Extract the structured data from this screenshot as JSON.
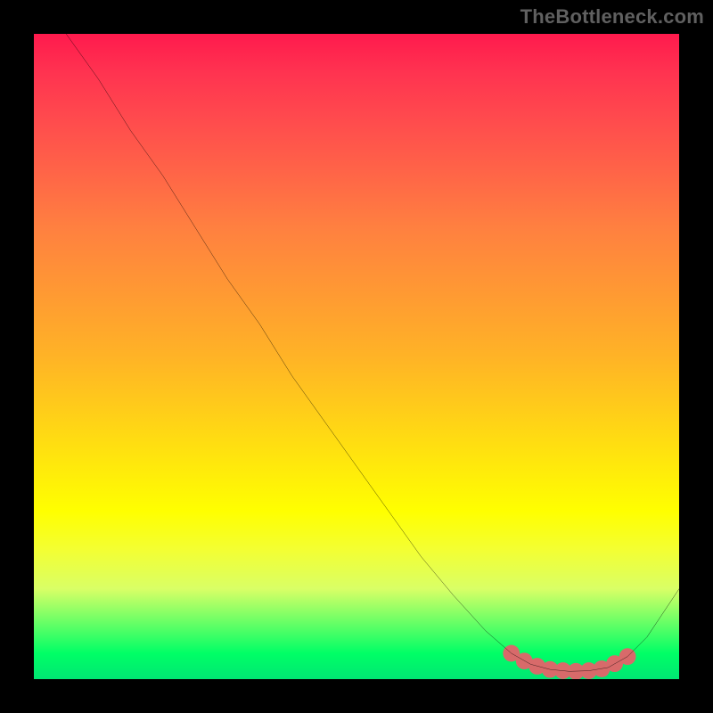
{
  "watermark": "TheBottleneck.com",
  "chart_data": {
    "type": "line",
    "title": "",
    "xlabel": "",
    "ylabel": "",
    "xlim": [
      0,
      100
    ],
    "ylim": [
      0,
      100
    ],
    "series": [
      {
        "name": "bottleneck-curve",
        "x": [
          5,
          10,
          15,
          20,
          25,
          30,
          35,
          40,
          45,
          50,
          55,
          60,
          65,
          70,
          74,
          77,
          80,
          83,
          86,
          89,
          92,
          95,
          100
        ],
        "y": [
          100,
          93,
          85,
          78,
          70,
          62,
          55,
          47,
          40,
          33,
          26,
          19,
          13,
          7.5,
          4,
          2.3,
          1.5,
          1.2,
          1.3,
          1.8,
          3.5,
          6.5,
          14
        ]
      }
    ],
    "highlight": {
      "name": "optimal-region-markers",
      "x": [
        74,
        76,
        78,
        80,
        82,
        84,
        86,
        88,
        90,
        92
      ],
      "y": [
        4,
        2.8,
        2.0,
        1.5,
        1.3,
        1.2,
        1.3,
        1.6,
        2.4,
        3.5
      ],
      "color": "#d86a6a",
      "radius": 9
    },
    "colors": {
      "curve": "#000000",
      "background_top": "#ff1a4d",
      "background_bottom": "#00e673",
      "frame": "#000000"
    }
  }
}
